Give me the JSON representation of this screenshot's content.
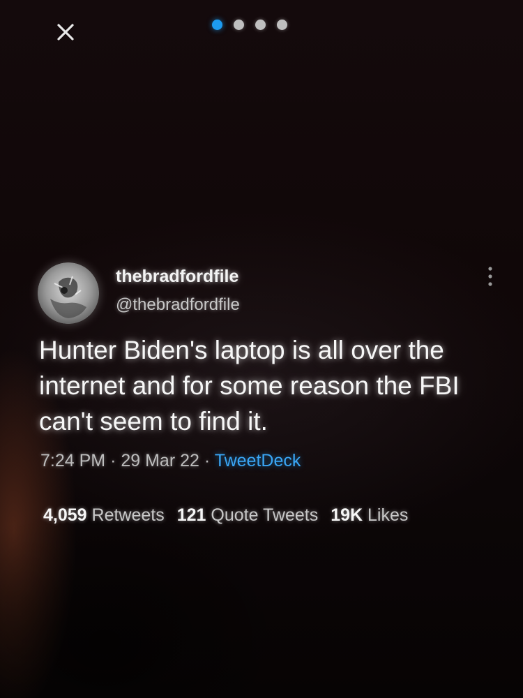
{
  "nav": {
    "close_icon": "close-icon",
    "dots": [
      {
        "active": true,
        "color": "#1d9bf0"
      },
      {
        "active": false,
        "color": "#bfbfbf"
      },
      {
        "active": false,
        "color": "#bfbfbf"
      },
      {
        "active": false,
        "color": "#bfbfbf"
      }
    ]
  },
  "tweet": {
    "display_name": "thebradfordfile",
    "handle": "@thebradfordfile",
    "text": "Hunter Biden's laptop is all over the internet and for some reason the FBI can't seem to find it.",
    "time": "7:24 PM",
    "separator": "·",
    "date": "29 Mar 22",
    "source": "TweetDeck",
    "more_icon": "more-vertical-icon"
  },
  "stats": {
    "retweets_count": "4,059",
    "retweets_label": "Retweets",
    "quotes_count": "121",
    "quotes_label": "Quote Tweets",
    "likes_count": "19K",
    "likes_label": "Likes"
  },
  "colors": {
    "accent": "#1d9bf0",
    "text": "#f7f7f7",
    "muted": "#bdbdbd"
  }
}
